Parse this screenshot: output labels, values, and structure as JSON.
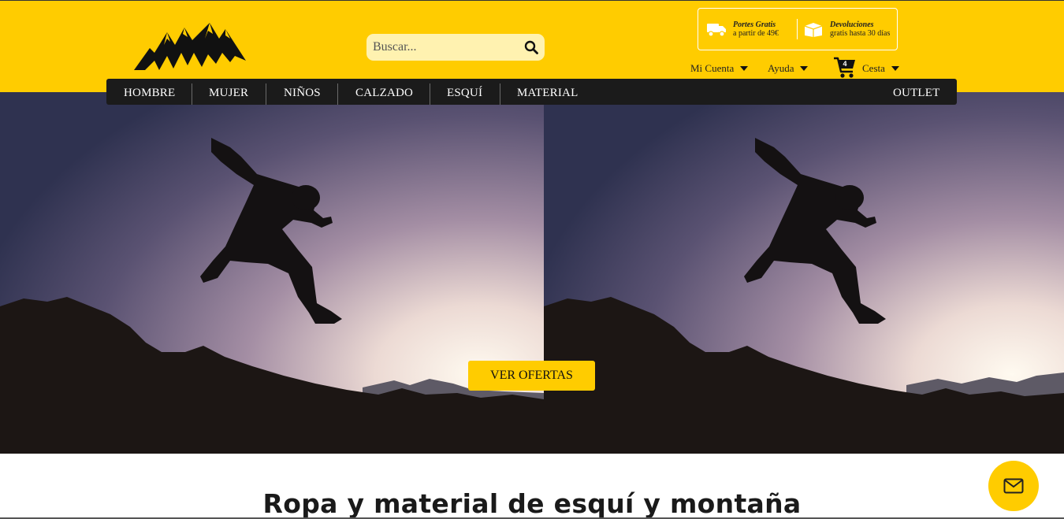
{
  "header": {
    "logo_icon": "mountains-logo",
    "search": {
      "placeholder": "Buscar...",
      "value": "",
      "icon": "search-icon"
    },
    "promo": [
      {
        "title": "Portes Gratis",
        "subtitle": "a partir de 49€",
        "icon": "truck-icon"
      },
      {
        "title": "Devoluciones",
        "subtitle": "gratis hasta 30 días",
        "icon": "box-icon"
      }
    ],
    "account": {
      "label": "Mi Cuenta"
    },
    "help": {
      "label": "Ayuda"
    },
    "cart": {
      "label": "Cesta",
      "count": "4",
      "icon": "cart-icon"
    }
  },
  "nav": {
    "items": [
      "HOMBRE",
      "MUJER",
      "NIÑOS",
      "CALZADO",
      "ESQUÍ",
      "MATERIAL"
    ],
    "outlet": "OUTLET"
  },
  "hero": {
    "cta_label": "VER OFERTAS"
  },
  "main": {
    "heading": "Ropa y material de esquí y montaña"
  },
  "floating": {
    "icon": "mail-icon"
  },
  "colors": {
    "brand": "#ffcc00",
    "nav_bg": "#1b1b1b"
  }
}
